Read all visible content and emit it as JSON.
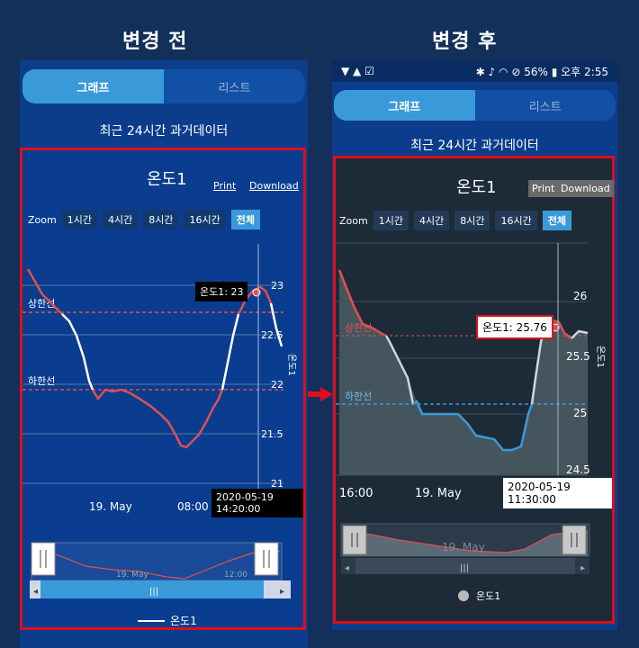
{
  "headings": {
    "before": "변경 전",
    "after": "변경 후"
  },
  "statusbar": {
    "battery": "56%",
    "ampm": "오후",
    "time": "2:55"
  },
  "tabs": {
    "graph": "그래프",
    "list": "리스트"
  },
  "subtitle": "최근 24시간 과거데이터",
  "chart": {
    "title": "온도1",
    "print": "Print",
    "download": "Download",
    "zoom_label": "Zoom",
    "zoom_buttons": [
      "1시간",
      "4시간",
      "8시간",
      "16시간",
      "전체"
    ],
    "upper_limit_label": "상한선",
    "lower_limit_label": "하한선",
    "axis_title": "온도1",
    "legend": "온도1"
  },
  "before": {
    "tooltip": "온도1: 23",
    "time_tooltip": "2020-05-19 14:20:00",
    "x_ticks": [
      "19. May",
      "08:00"
    ],
    "y_ticks": [
      "23",
      "22.5",
      "22",
      "21.5",
      "21"
    ],
    "navigator_labels": [
      "19. May",
      "12:00"
    ]
  },
  "after": {
    "tooltip": "온도1: 25.76",
    "time_tooltip": "2020-05-19 11:30:00",
    "x_ticks": [
      "16:00",
      "19. May"
    ],
    "y_ticks": [
      "26",
      "25.5",
      "25",
      "24.5"
    ],
    "navigator_label": "19. May"
  },
  "colors": {
    "accent": "#3a9ad9",
    "highlight": "#e00d1a",
    "over_limit": "#e05050",
    "below_limit": "#3a9ad9"
  }
}
